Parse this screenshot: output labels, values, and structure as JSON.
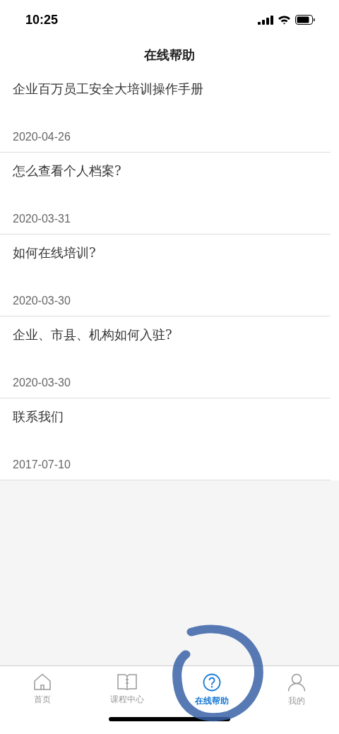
{
  "status_bar": {
    "time": "10:25"
  },
  "header": {
    "title": "在线帮助"
  },
  "articles": [
    {
      "title": "企业百万员工安全大培训操作手册",
      "date": "2020-04-26"
    },
    {
      "title": "怎么查看个人档案?",
      "date": "2020-03-31"
    },
    {
      "title": "如何在线培训?",
      "date": "2020-03-30"
    },
    {
      "title": "企业、市县、机构如何入驻?",
      "date": "2020-03-30"
    },
    {
      "title": "联系我们",
      "date": "2017-07-10"
    }
  ],
  "tab_bar": [
    {
      "kind": "home",
      "label": "首页",
      "selected": false
    },
    {
      "kind": "book",
      "label": "课程中心",
      "selected": false
    },
    {
      "kind": "help",
      "label": "在线帮助",
      "selected": true
    },
    {
      "kind": "person",
      "label": "我的",
      "selected": false
    }
  ]
}
